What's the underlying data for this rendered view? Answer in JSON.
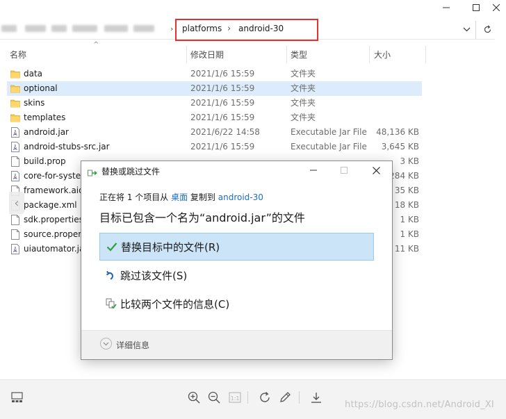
{
  "address_bar": {
    "path": [
      "platforms",
      "android-30"
    ]
  },
  "columns": {
    "name": "名称",
    "date": "修改日期",
    "type": "类型",
    "size": "大小"
  },
  "files": [
    {
      "name": "data",
      "date": "2021/1/6 15:59",
      "type": "文件夹",
      "size": "",
      "icon": "folder-icon"
    },
    {
      "name": "optional",
      "date": "2021/1/6 15:59",
      "type": "文件夹",
      "size": "",
      "icon": "folder-icon",
      "selected": true
    },
    {
      "name": "skins",
      "date": "2021/1/6 15:59",
      "type": "文件夹",
      "size": "",
      "icon": "folder-icon"
    },
    {
      "name": "templates",
      "date": "2021/1/6 15:59",
      "type": "文件夹",
      "size": "",
      "icon": "folder-icon"
    },
    {
      "name": "android.jar",
      "date": "2021/6/22 14:58",
      "type": "Executable Jar File",
      "size": "48,136 KB",
      "icon": "jar-file-icon"
    },
    {
      "name": "android-stubs-src.jar",
      "date": "2021/1/6 15:59",
      "type": "Executable Jar File",
      "size": "3,645 KB",
      "icon": "jar-file-icon"
    },
    {
      "name": "build.prop",
      "date": "",
      "type": "",
      "size": "3 KB",
      "icon": "document-icon"
    },
    {
      "name": "core-for-syste",
      "date": "",
      "type": "",
      "size": "284 KB",
      "icon": "jar-file-icon"
    },
    {
      "name": "framework.aid",
      "date": "",
      "type": "",
      "size": "35 KB",
      "icon": "document-icon"
    },
    {
      "name": "package.xml",
      "date": "",
      "type": "",
      "size": "18 KB",
      "icon": "document-icon"
    },
    {
      "name": "sdk.properties",
      "date": "",
      "type": "",
      "size": "1 KB",
      "icon": "document-icon"
    },
    {
      "name": "source.proper",
      "date": "",
      "type": "",
      "size": "1 KB",
      "icon": "document-icon"
    },
    {
      "name": "uiautomator.ja",
      "date": "",
      "type": "",
      "size": "11 KB",
      "icon": "jar-file-icon"
    }
  ],
  "dialog": {
    "title": "替换或跳过文件",
    "line_prefix": "正在将 1 个项目从 ",
    "source": "桌面",
    "line_middle": " 复制到 ",
    "destination": "android-30",
    "heading": "目标已包含一个名为“android.jar”的文件",
    "options": [
      {
        "label": "替换目标中的文件(R)",
        "icon": "checkmark-icon"
      },
      {
        "label": "跳过该文件(S)",
        "icon": "skip-arrow-icon"
      },
      {
        "label": "比较两个文件的信息(C)",
        "icon": "compare-files-icon"
      }
    ],
    "details_label": "详细信息"
  },
  "watermark": "https://blog.csdn.net/Android_XI",
  "colors": {
    "accent": "#1a6fc4",
    "selection": "#dcecfc",
    "primary_option": "#cce4f7",
    "highlight_box": "#e8312f"
  }
}
